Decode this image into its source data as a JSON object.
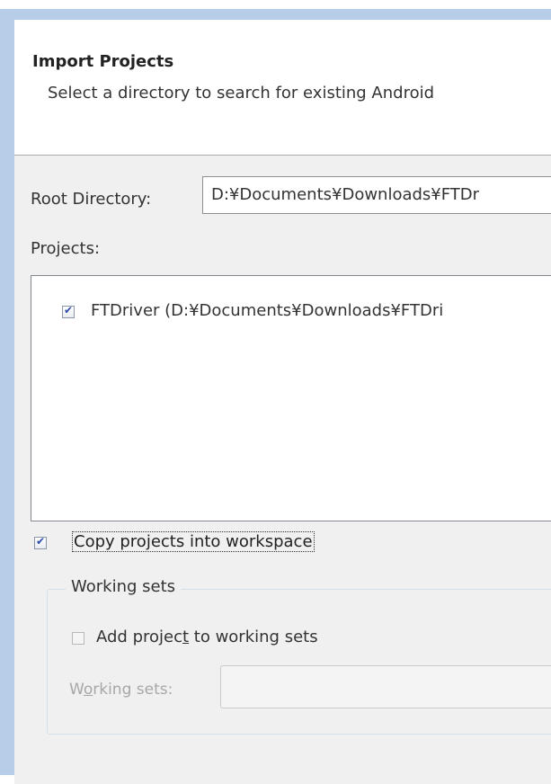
{
  "dialog": {
    "title": "Import Projects",
    "subtitle": "Select a directory to search for existing Android"
  },
  "root_directory": {
    "label": "Root Directory:",
    "value": "D:¥Documents¥Downloads¥FTDr"
  },
  "projects": {
    "label": "Projects:",
    "items": [
      {
        "label": "FTDriver (D:¥Documents¥Downloads¥FTDri",
        "checked": true
      }
    ]
  },
  "copy_projects": {
    "label": "Copy projects into workspace",
    "checked": true
  },
  "working_sets_group": {
    "legend": "Working sets",
    "add_label_pre": "Add projec",
    "add_label_mnemonic": "t",
    "add_label_post": " to working sets",
    "add_checked": false,
    "field_label_pre": "W",
    "field_label_mnemonic": "o",
    "field_label_post": "rking sets:",
    "field_value": ""
  }
}
